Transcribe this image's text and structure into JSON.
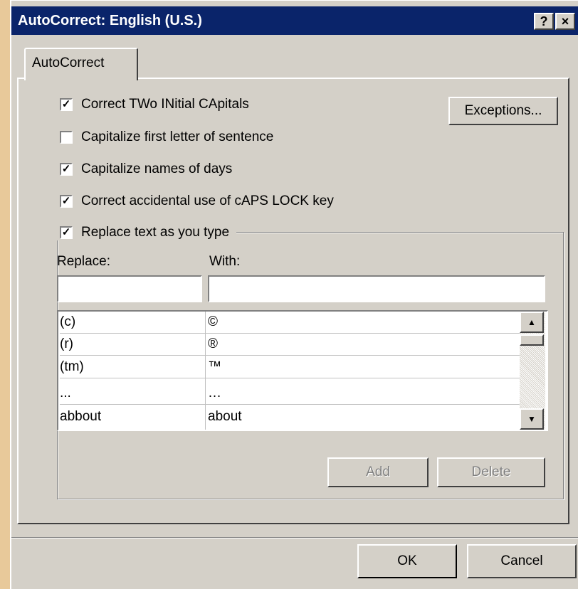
{
  "window": {
    "title": "AutoCorrect: English (U.S.)",
    "help_btn": "?",
    "close_btn": "×"
  },
  "tabs": [
    {
      "label": "AutoCorrect",
      "active": true
    }
  ],
  "options": {
    "two_initial_caps": {
      "label": "Correct TWo INitial CApitals",
      "checked": true
    },
    "first_letter": {
      "label": "Capitalize first letter of sentence",
      "checked": false
    },
    "names_of_days": {
      "label": "Capitalize names of days",
      "checked": true
    },
    "caps_lock": {
      "label": "Correct accidental use of cAPS LOCK key",
      "checked": true
    },
    "replace_text": {
      "label": "Replace text as you type",
      "checked": true
    }
  },
  "exceptions_button": "Exceptions...",
  "replace": {
    "label": "Replace:",
    "value": ""
  },
  "with": {
    "label": "With:",
    "value": ""
  },
  "entries": [
    {
      "replace": "(c)",
      "with": "©"
    },
    {
      "replace": "(r)",
      "with": "®"
    },
    {
      "replace": "(tm)",
      "with": "™"
    },
    {
      "replace": "...",
      "with": "…"
    },
    {
      "replace": "abbout",
      "with": "about"
    }
  ],
  "buttons": {
    "add": "Add",
    "delete": "Delete",
    "ok": "OK",
    "cancel": "Cancel"
  },
  "colors": {
    "titlebar": "#0a246a",
    "face": "#d4d0c8",
    "background": "#e8c99a"
  }
}
